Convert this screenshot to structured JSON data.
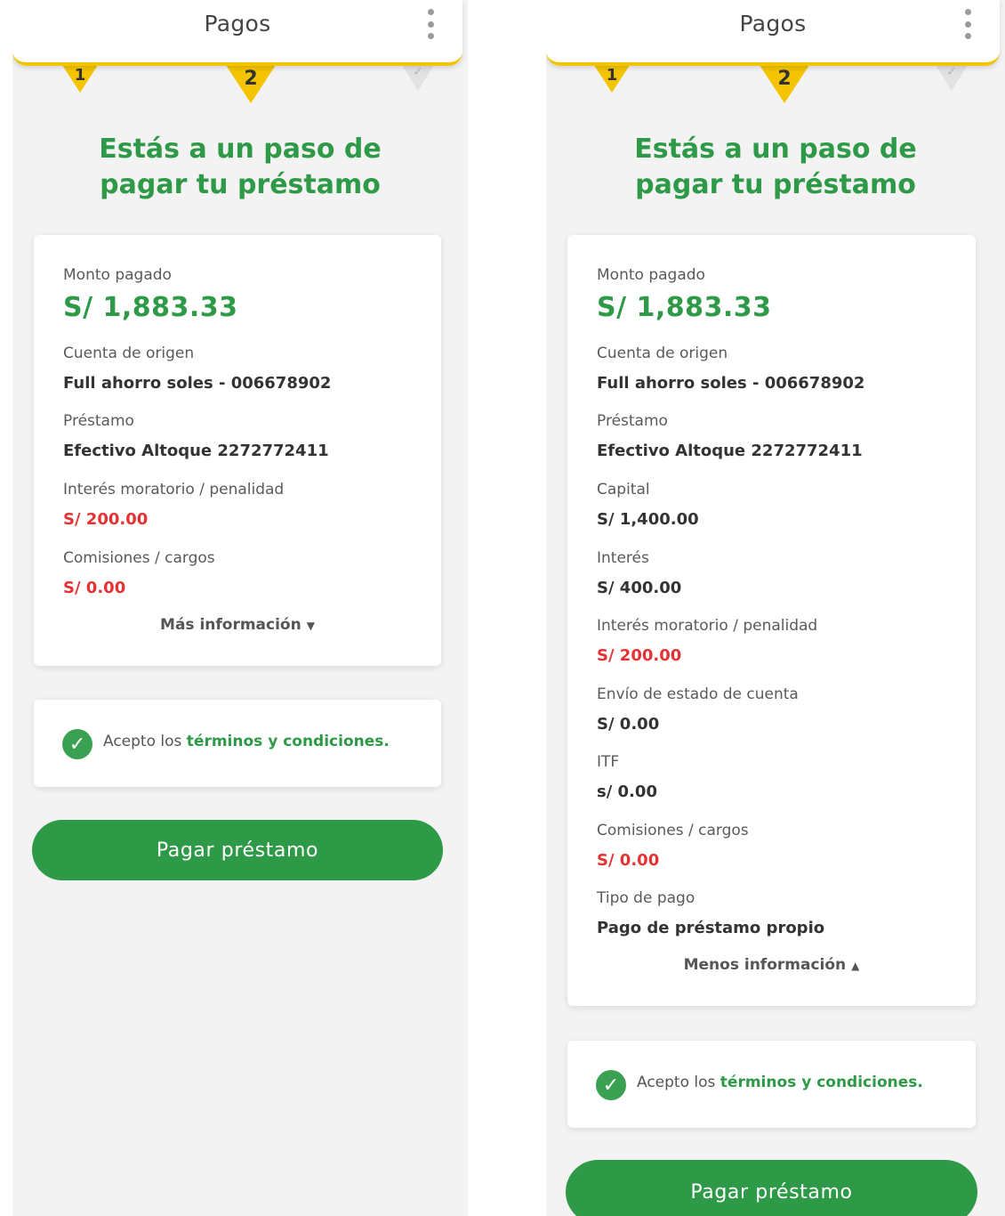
{
  "left": {
    "header": {
      "title": "Pagos",
      "menu_icon": "more-vertical-icon"
    },
    "stepper": {
      "step1": "1",
      "step2": "2",
      "step3": "✓"
    },
    "headline": {
      "line1": "Estás a un paso de",
      "line2": "pagar tu préstamo"
    },
    "summary": {
      "monto_label": "Monto pagado",
      "monto_value": "S/ 1,883.33",
      "fields": [
        {
          "label": "Cuenta de origen",
          "value": "Full ahorro soles - 006678902",
          "color": "#333333"
        },
        {
          "label": "Préstamo",
          "value": "Efectivo Altoque 2272772411",
          "color": "#333333"
        },
        {
          "label": "Interés moratorio / penalidad",
          "value": "S/ 200.00",
          "color": "#e63232"
        },
        {
          "label": "Comisiones / cargos",
          "value": "S/ 0.00",
          "color": "#e63232"
        }
      ],
      "toggle_label": "Más información",
      "toggle_icon": "caret-down-icon"
    },
    "terms": {
      "prefix": "Acepto los ",
      "link": "términos y condiciones.",
      "checked": true
    },
    "pay_button": "Pagar préstamo"
  },
  "right": {
    "header": {
      "title": "Pagos",
      "menu_icon": "more-vertical-icon"
    },
    "stepper": {
      "step1": "1",
      "step2": "2",
      "step3": "✓"
    },
    "headline": {
      "line1": "Estás a un paso de",
      "line2": "pagar tu préstamo"
    },
    "summary": {
      "monto_label": "Monto pagado",
      "monto_value": "S/ 1,883.33",
      "fields": [
        {
          "label": "Cuenta de origen",
          "value": "Full ahorro soles - 006678902",
          "color": "#333333"
        },
        {
          "label": "Préstamo",
          "value": "Efectivo Altoque 2272772411",
          "color": "#333333"
        },
        {
          "label": "Capital",
          "value": "S/ 1,400.00",
          "color": "#333333"
        },
        {
          "label": "Interés",
          "value": "S/ 400.00",
          "color": "#333333"
        },
        {
          "label": "Interés moratorio / penalidad",
          "value": "S/ 200.00",
          "color": "#e63232"
        },
        {
          "label": "Envío de estado de cuenta",
          "value": "S/ 0.00",
          "color": "#333333"
        },
        {
          "label": "ITF",
          "value": "s/ 0.00",
          "color": "#333333"
        },
        {
          "label": "Comisiones / cargos",
          "value": "S/ 0.00",
          "color": "#e63232"
        },
        {
          "label": "Tipo de pago",
          "value": "Pago de préstamo propio",
          "color": "#333333"
        }
      ],
      "toggle_label": "Menos información",
      "toggle_icon": "caret-up-icon"
    },
    "terms": {
      "prefix": "Acepto los ",
      "link": "términos y condiciones.",
      "checked": true
    },
    "pay_button": "Pagar préstamo"
  },
  "colors": {
    "brand_green": "#2e9a47",
    "accent_yellow": "#f4c400",
    "alert_red": "#e63232"
  }
}
